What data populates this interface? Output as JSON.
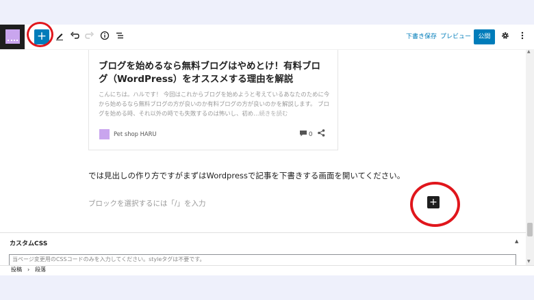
{
  "toolbar": {
    "add_block": "+",
    "save_draft": "下書き保存",
    "preview": "プレビュー",
    "publish": "公開"
  },
  "card": {
    "title": "ブログを始めるなら無料ブログはやめとけ！有料ブログ（WordPress）をオススメする理由を解説",
    "excerpt": "こんにちは。ハルです！ 今回はこれからブログを始めようと考えているあなたのために今から始めるなら無料ブログの方が良いのか有料ブログの方が良いのかを解説します。 ブログを始める時、それ以外の時でも失敗するのは怖いし、初め…",
    "read_more": "続きを読む",
    "author": "Pet shop HARU",
    "comment_count": "0"
  },
  "paragraph": "では見出しの作り方ですがまずはWordpressで記事を下書きする画面を開いてください。",
  "placeholder": "ブロックを選択するには「/」を入力",
  "block_add": "+",
  "panel": {
    "title": "カスタムCSS",
    "input_placeholder": "当ページ変更用のCSSコードのみを入力してください。styleタグは不要です。"
  },
  "breadcrumb": {
    "item1": "投稿",
    "separator": "›",
    "item2": "段落"
  },
  "colors": {
    "accent": "#007cba",
    "highlight_ring": "#e0161c",
    "site_icon": "#c9a5ee"
  }
}
